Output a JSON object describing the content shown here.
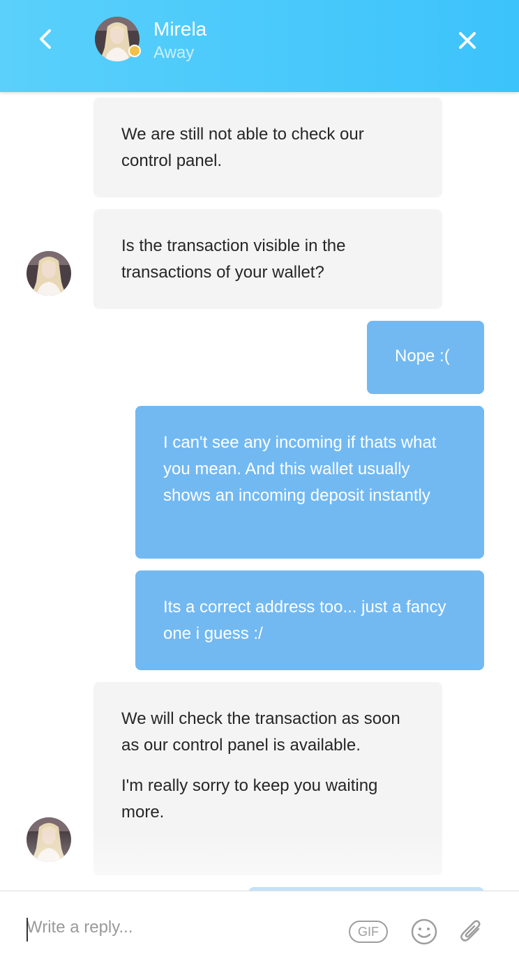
{
  "header": {
    "name": "Mirela",
    "status": "Away",
    "status_color": "#f2c14a",
    "back_icon": "chevron-left-icon",
    "close_icon": "close-icon",
    "background": "#3cc3fb"
  },
  "messages": [
    {
      "from": "agent",
      "paragraphs": [
        "We are still not able to check our control panel."
      ]
    },
    {
      "from": "agent",
      "paragraphs": [
        "Is the transaction visible in the transactions of your wallet?"
      ]
    },
    {
      "from": "user",
      "paragraphs": [
        "Nope :("
      ]
    },
    {
      "from": "user",
      "paragraphs": [
        "I can't see any incoming if thats what you mean. And this wallet usually shows an incoming deposit instantly"
      ]
    },
    {
      "from": "user",
      "paragraphs": [
        "Its a correct address too... just a fancy one i guess :/"
      ]
    },
    {
      "from": "agent",
      "paragraphs": [
        "We will check the transaction as soon as our control panel is available.",
        "I'm really sorry to keep you waiting more."
      ]
    }
  ],
  "composer": {
    "placeholder": "Write a reply...",
    "gif_label": "GIF",
    "emoji_icon": "smiley-icon",
    "attach_icon": "paperclip-icon"
  },
  "colors": {
    "agent_bubble": "#f4f4f4",
    "user_bubble": "#72b9f2"
  }
}
